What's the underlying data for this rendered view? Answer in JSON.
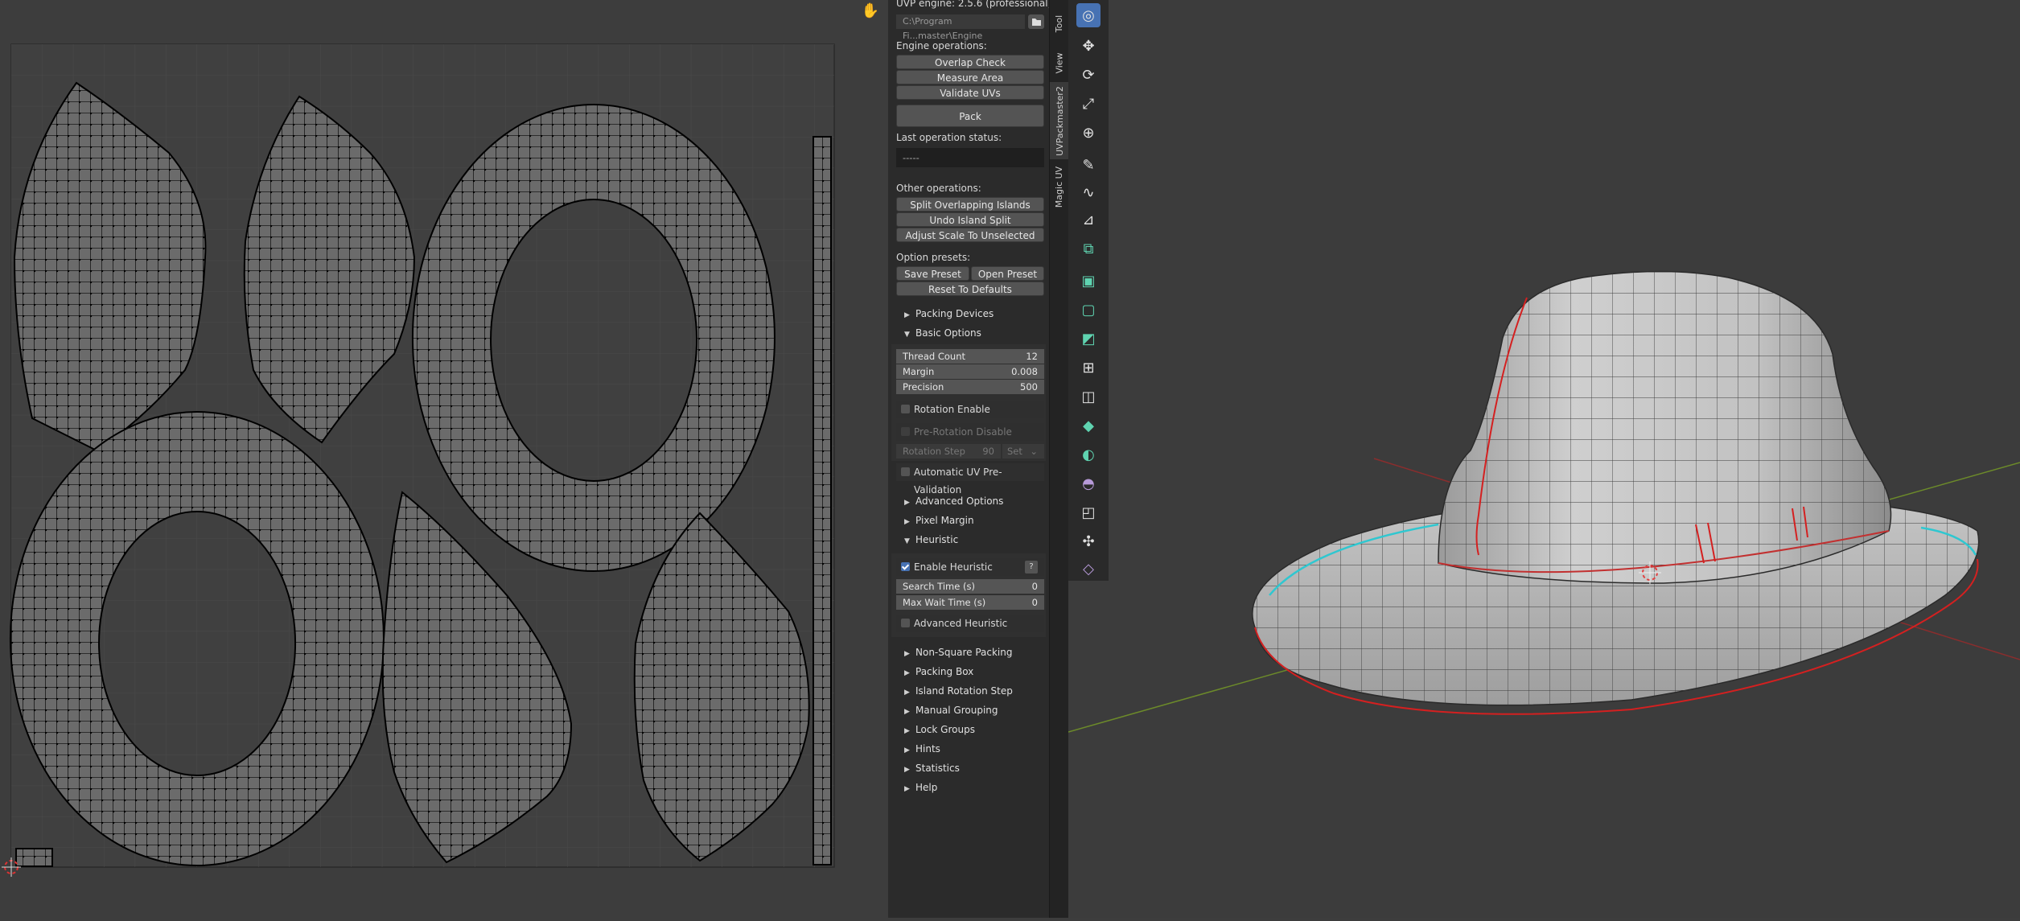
{
  "panel": {
    "title": "UVP engine: 2.5.6 (professional)",
    "path": "C:\\Program Fi...master\\Engine",
    "engine_ops_label": "Engine operations:",
    "engine_ops": [
      "Overlap Check",
      "Measure Area",
      "Validate UVs"
    ],
    "pack_label": "Pack",
    "last_status_label": "Last operation status:",
    "last_status_value": "-----",
    "other_ops_label": "Other operations:",
    "other_ops": [
      "Split Overlapping Islands",
      "Undo Island Split",
      "Adjust Scale To Unselected"
    ],
    "presets_label": "Option presets:",
    "save_preset": "Save Preset",
    "open_preset": "Open Preset",
    "reset_defaults": "Reset To Defaults",
    "packing_devices": "Packing Devices",
    "basic_options": "Basic Options",
    "thread_count_label": "Thread Count",
    "thread_count_value": "12",
    "margin_label": "Margin",
    "margin_value": "0.008",
    "precision_label": "Precision",
    "precision_value": "500",
    "rotation_enable": "Rotation Enable",
    "pre_rotation_disable": "Pre-Rotation Disable",
    "rotation_step_label": "Rotation Step",
    "rotation_step_value": "90",
    "rotation_step_set": "Set",
    "auto_uv_prevalidation": "Automatic UV Pre-Validation",
    "advanced_options": "Advanced Options",
    "pixel_margin": "Pixel Margin",
    "heuristic": "Heuristic",
    "enable_heuristic": "Enable Heuristic",
    "help_glyph": "?",
    "search_time_label": "Search Time (s)",
    "search_time_value": "0",
    "max_wait_label": "Max Wait Time (s)",
    "max_wait_value": "0",
    "advanced_heuristic": "Advanced Heuristic",
    "sections_rest": [
      "Non-Square Packing",
      "Packing Box",
      "Island Rotation Step",
      "Manual Grouping",
      "Lock Groups",
      "Hints",
      "Statistics",
      "Help"
    ]
  },
  "tabs": {
    "tool": "Tool",
    "view": "View",
    "uvpackmaster": "UVPackmaster2",
    "magic_uv": "Magic UV"
  },
  "tools": [
    "cursor-icon",
    "move-icon",
    "rotate-icon",
    "scale-icon",
    "transform-icon",
    "annotate-icon",
    "annotate-line-icon",
    "measure-icon",
    "add-cube-icon",
    "extrude-icon",
    "inset-icon",
    "bevel-icon",
    "loop-cut-icon",
    "knife-icon",
    "poly-build-icon",
    "spin-icon",
    "smooth-icon",
    "edge-slide-icon",
    "shrink-icon",
    "shear-icon",
    "rip-icon"
  ],
  "colors": {
    "seam": "#d42020",
    "boundary": "#2fc7d0",
    "xaxis": "#8a2d2d",
    "yaxis": "#6c8a2a",
    "accent": "#4772b3"
  }
}
